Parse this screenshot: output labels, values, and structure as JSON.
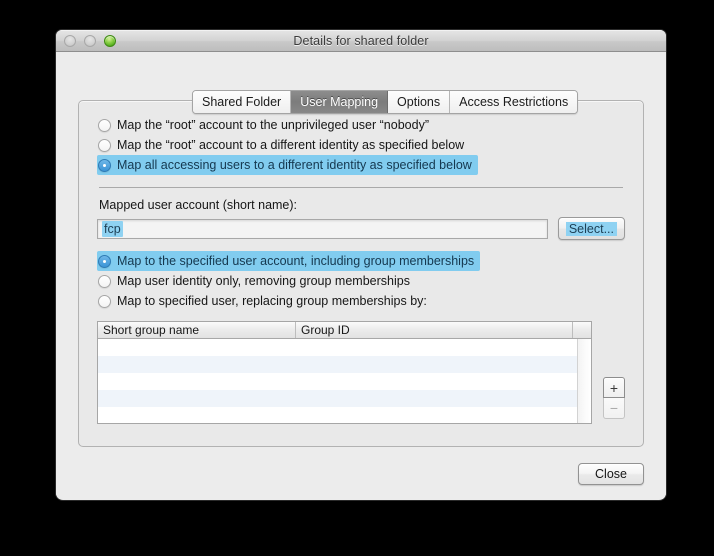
{
  "window": {
    "title": "Details for shared folder",
    "traffic_lights": [
      {
        "name": "close-button",
        "color": "#d2d2d2",
        "state": "disabled"
      },
      {
        "name": "minimize-button",
        "color": "#d2d2d2",
        "state": "disabled"
      },
      {
        "name": "zoom-button",
        "color": "#8ed24a",
        "state": "enabled"
      }
    ]
  },
  "tabs": [
    {
      "label": "Shared Folder",
      "selected": false
    },
    {
      "label": "User Mapping",
      "selected": true
    },
    {
      "label": "Options",
      "selected": false
    },
    {
      "label": "Access Restrictions",
      "selected": false
    }
  ],
  "mapping_mode": {
    "options": [
      {
        "label": "Map the “root” account to the unprivileged user “nobody”",
        "selected": false,
        "highlighted": false
      },
      {
        "label": "Map the “root” account to a different identity as specified below",
        "selected": false,
        "highlighted": false
      },
      {
        "label": "Map all accessing users to a different identity as specified below",
        "selected": true,
        "highlighted": true
      }
    ]
  },
  "mapped_account": {
    "label": "Mapped user account (short name):",
    "value": "fcp",
    "placeholder": "",
    "select_button_label": "Select..."
  },
  "group_mode": {
    "options": [
      {
        "label": "Map to the specified user account, including group memberships",
        "selected": true,
        "highlighted": true
      },
      {
        "label": "Map user identity only, removing group memberships",
        "selected": false,
        "highlighted": false
      },
      {
        "label": "Map to specified user, replacing group memberships by:",
        "selected": false,
        "highlighted": false
      }
    ]
  },
  "group_table": {
    "columns": [
      "Short group name",
      "Group ID",
      ""
    ],
    "rows": [],
    "empty_row_count": 5,
    "add_button_label": "+",
    "remove_button_label": "−"
  },
  "footer": {
    "close_label": "Close"
  },
  "colors": {
    "selection_highlight": "#81ccef",
    "selection_text": "#15384f",
    "field_selection": "#8fd2f2",
    "window_background": "#ececec",
    "zoom_button_green": "#8ed24a"
  }
}
